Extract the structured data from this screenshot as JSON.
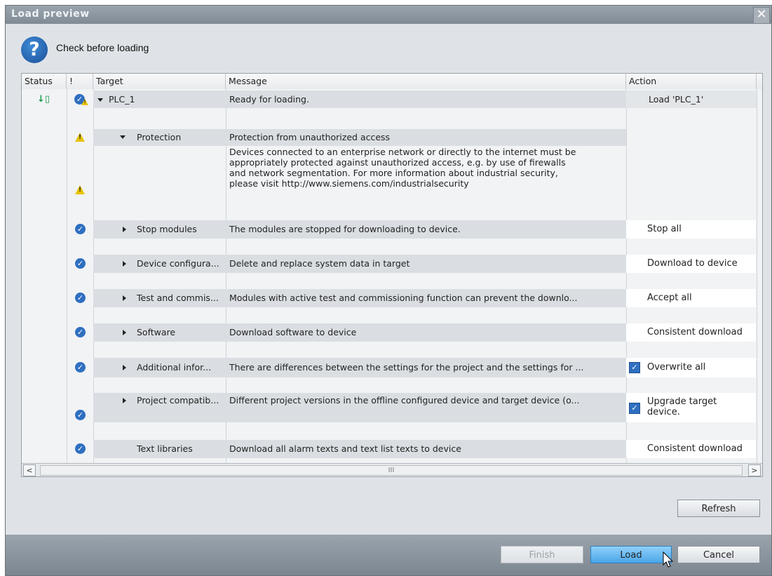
{
  "window": {
    "title": "Load preview",
    "close_icon": "close-icon"
  },
  "header": {
    "text": "Check before loading",
    "icon": "question-icon"
  },
  "columns": {
    "status": "Status",
    "flag": "!",
    "target": "Target",
    "message": "Message",
    "action": "Action"
  },
  "rows": {
    "plc": {
      "target": "PLC_1",
      "message": "Ready for loading.",
      "action": "Load 'PLC_1'"
    },
    "protection": {
      "target": "Protection",
      "message": "Protection from unauthorized access"
    },
    "protection_detail": {
      "line1": "Devices connected to an enterprise network or directly to the internet must be",
      "line2": "appropriately protected against unauthorized access, e.g. by use of firewalls",
      "line3": "and network segmentation. For more information about industrial security,",
      "line4": "please visit  http://www.siemens.com/industrialsecurity"
    },
    "stop": {
      "target": "Stop modules",
      "message": "The modules are stopped for downloading to device.",
      "action": "Stop all"
    },
    "devconf": {
      "target": "Device configura...",
      "message": "Delete and replace system data in target",
      "action": "Download to device"
    },
    "test": {
      "target": "Test and commis...",
      "message": "Modules with active test and commissioning function can prevent the downlo...",
      "action": "Accept all"
    },
    "software": {
      "target": "Software",
      "message": "Download software to device",
      "action": "Consistent download"
    },
    "additional": {
      "target": "Additional infor...",
      "message": "There are differences between the settings for the project and the settings for ...",
      "action": "Overwrite all"
    },
    "compat": {
      "target": "Project compatib...",
      "message": "Different project versions in the offline configured device and target device (o...",
      "action_line1": "Upgrade target",
      "action_line2": "device."
    },
    "textlib": {
      "target": "Text libraries",
      "message": "Download all alarm texts and text list texts to device",
      "action": "Consistent download"
    }
  },
  "scrollbar": {
    "left": "<",
    "right": ">",
    "grip": "III"
  },
  "buttons": {
    "refresh": "Refresh",
    "finish": "Finish",
    "load": "Load",
    "cancel": "Cancel"
  },
  "colors": {
    "accent": "#2f6fc0",
    "warning": "#e8c200",
    "load_button": "#4aa6e8"
  }
}
